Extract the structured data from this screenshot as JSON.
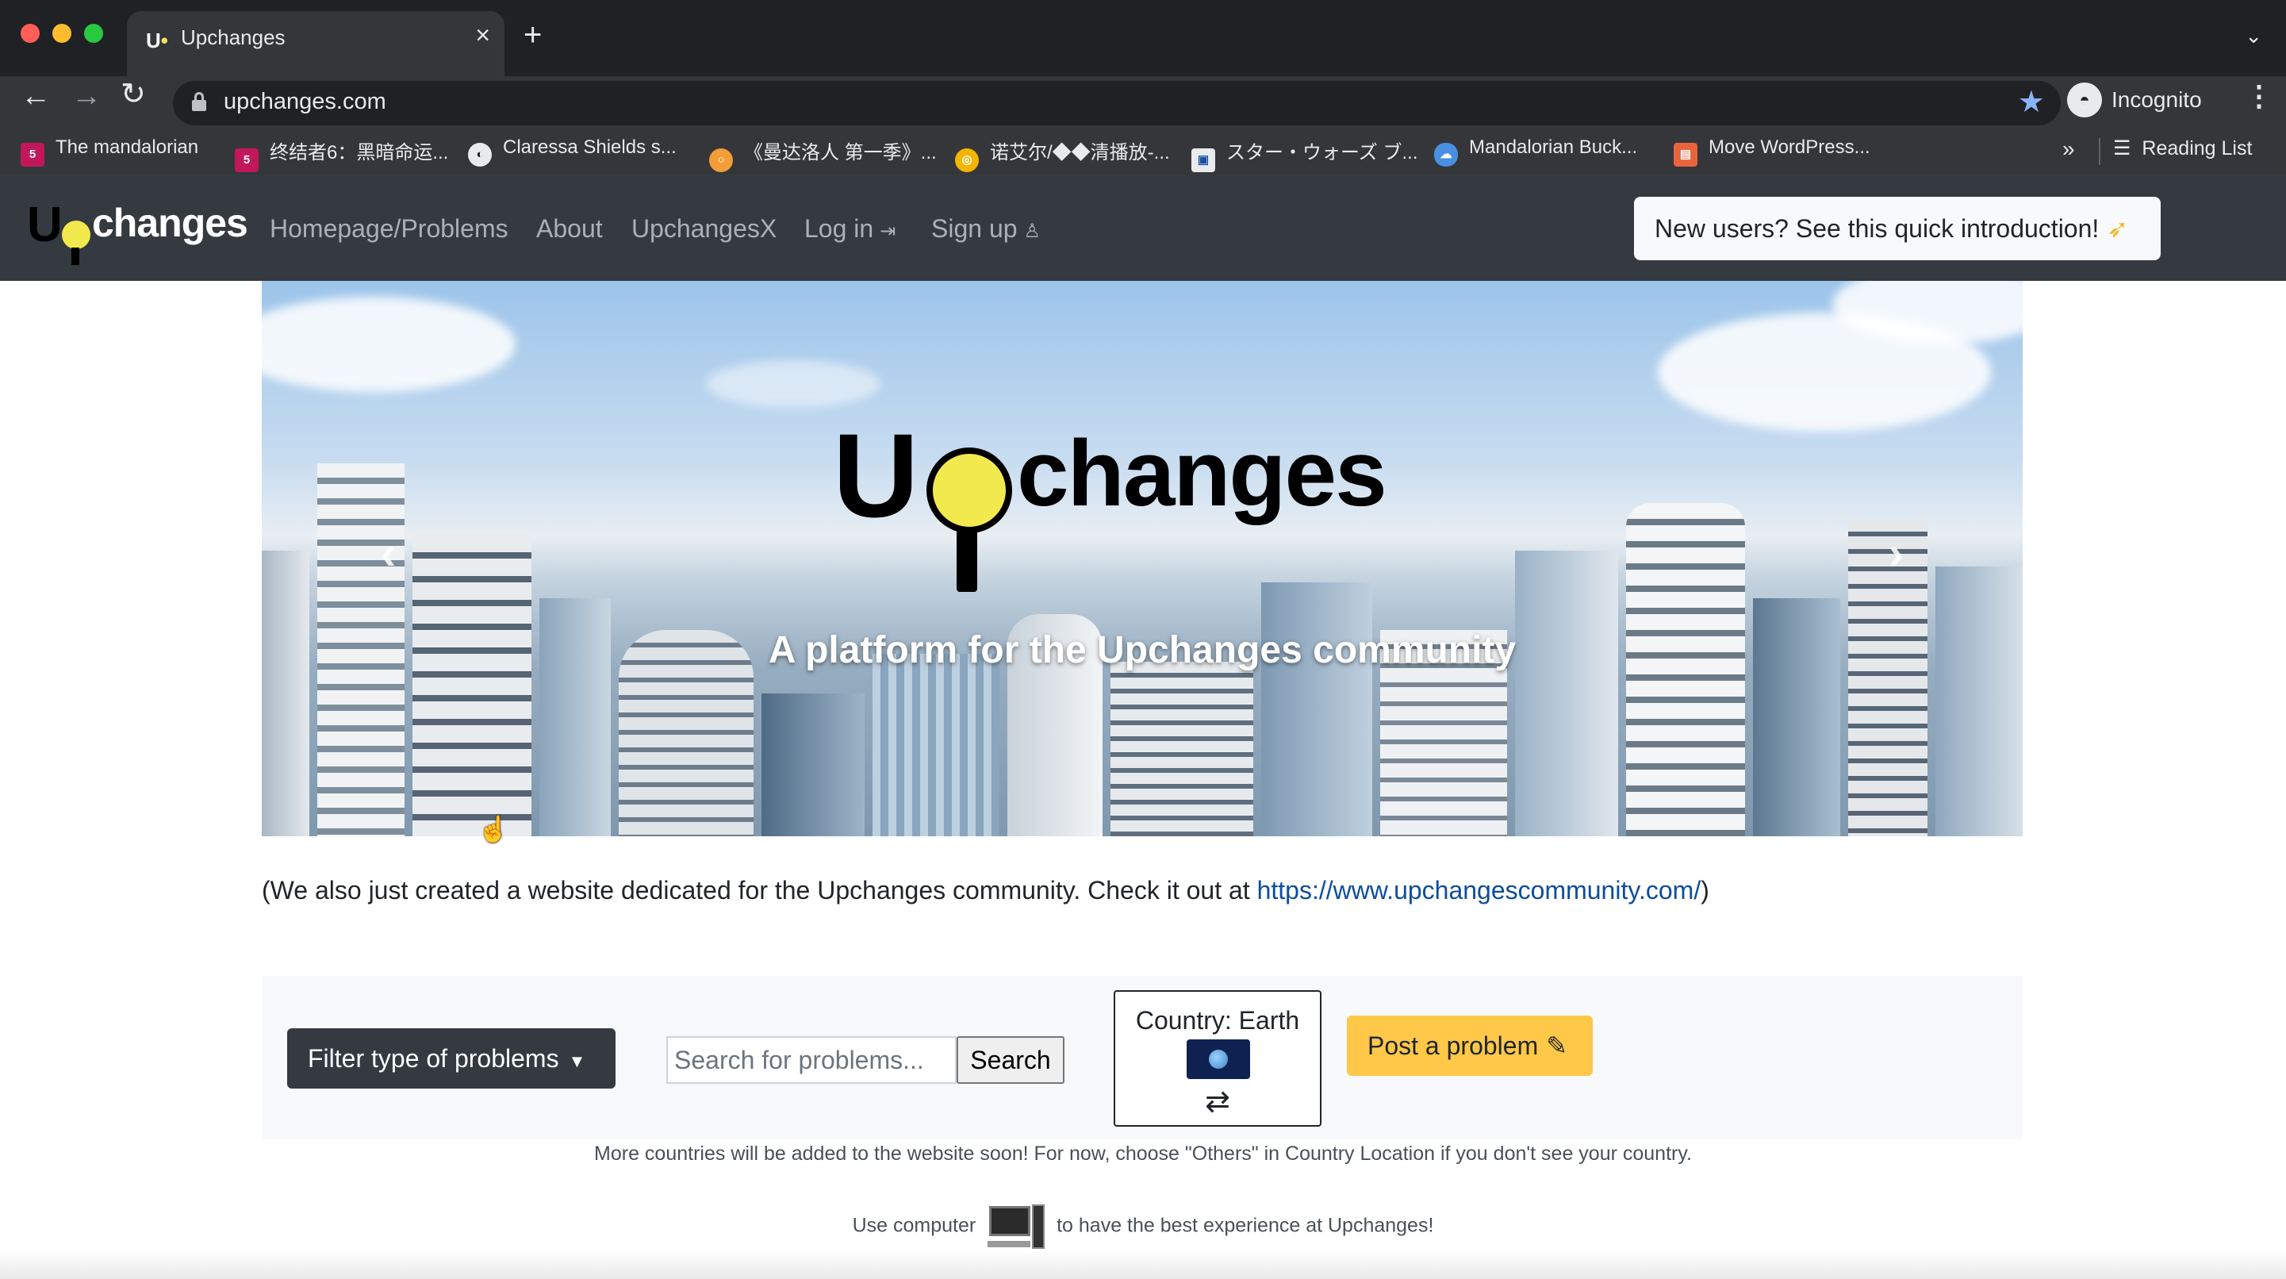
{
  "browser": {
    "tab_title": "Upchanges",
    "url": "upchanges.com",
    "profile_label": "Incognito",
    "bookmarks": [
      {
        "label": "The mandalorian",
        "icon": "520-icon"
      },
      {
        "label": "终结者6：黑暗命运...",
        "icon": "520-icon"
      },
      {
        "label": "Claressa Shields s...",
        "icon": "globe-icon"
      },
      {
        "label": "《曼达洛人 第一季》...",
        "icon": "search-icon"
      },
      {
        "label": "诺艾尔/◆◆清播放-...",
        "icon": "circle-icon"
      },
      {
        "label": "スター・ウォーズ ブ...",
        "icon": "image-icon"
      },
      {
        "label": "Mandalorian Buck...",
        "icon": "cloud-icon"
      },
      {
        "label": "Move WordPress...",
        "icon": "box-icon"
      }
    ],
    "reading_list": "Reading List"
  },
  "site": {
    "logo_text": "changes",
    "logo_u": "U",
    "nav": {
      "home": "Homepage/Problems",
      "about": "About",
      "upchangesx": "UpchangesX",
      "login": "Log in",
      "signup": "Sign up"
    },
    "intro_button": "New users? See this quick introduction!"
  },
  "hero": {
    "logo_u": "U",
    "logo_text": "changes",
    "subtitle": "A platform for the Upchanges community"
  },
  "notice": {
    "text": "(We also just created a website dedicated for the Upchanges community. Check it out at ",
    "link": "https://www.upchangescommunity.com/",
    "close": ")"
  },
  "filters": {
    "filter_button": "Filter type of problems",
    "search_placeholder": "Search for problems...",
    "search_button": "Search",
    "country_label": "Country: Earth",
    "post_button": "Post a problem"
  },
  "footer_notes": {
    "countries": "More countries will be added to the website soon! For now, choose \"Others\" in Country Location if you don't see your country.",
    "computer_prefix": "Use computer",
    "computer_suffix": "to have the best experience at Upchanges!"
  },
  "colors": {
    "navbar": "#343a40",
    "accent_yellow": "#ffc848",
    "link": "#0d4d9c",
    "bulb": "#f2e94e"
  }
}
